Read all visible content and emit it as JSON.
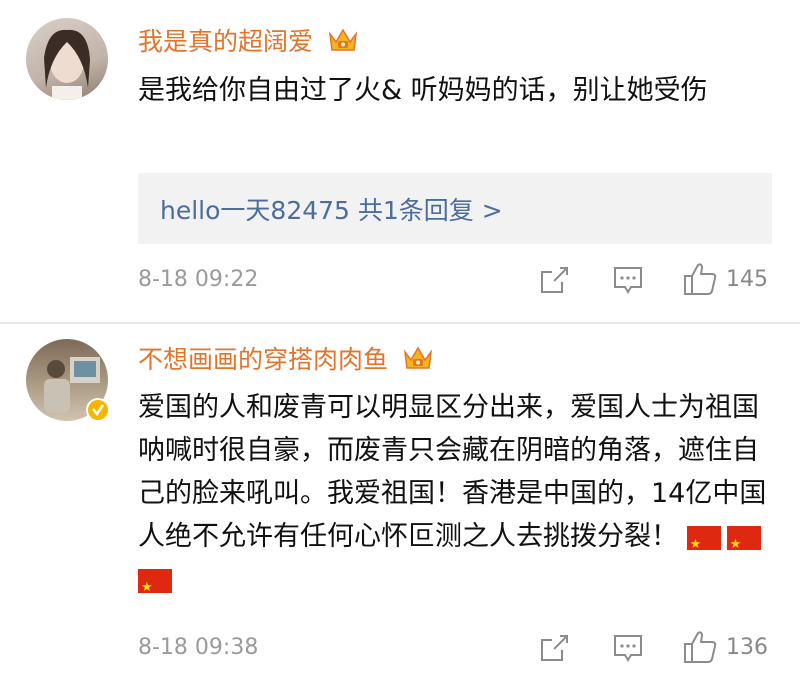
{
  "comments": [
    {
      "username": "我是真的超阔爱",
      "text": "是我给你自由过了火& 听妈妈的话，别让她受伤",
      "reply_link": "hello一天82475  共1条回复 >",
      "time": "8-18 09:22",
      "likes": "145"
    },
    {
      "username": "不想画画的穿搭肉肉鱼",
      "text": "爱国的人和废青可以明显区分出来，爱国人士为祖国呐喊时很自豪，而废青只会藏在阴暗的角落，遮住自己的脸来吼叫。我爱祖国！香港是中国的，14亿中国人绝不允许有任何心怀叵测之人去挑拨分裂！",
      "time": "8-18 09:38",
      "likes": "136"
    }
  ],
  "colors": {
    "username": "#e5742b",
    "reply_link": "#4a6d9c",
    "meta": "#9a9a9a"
  }
}
